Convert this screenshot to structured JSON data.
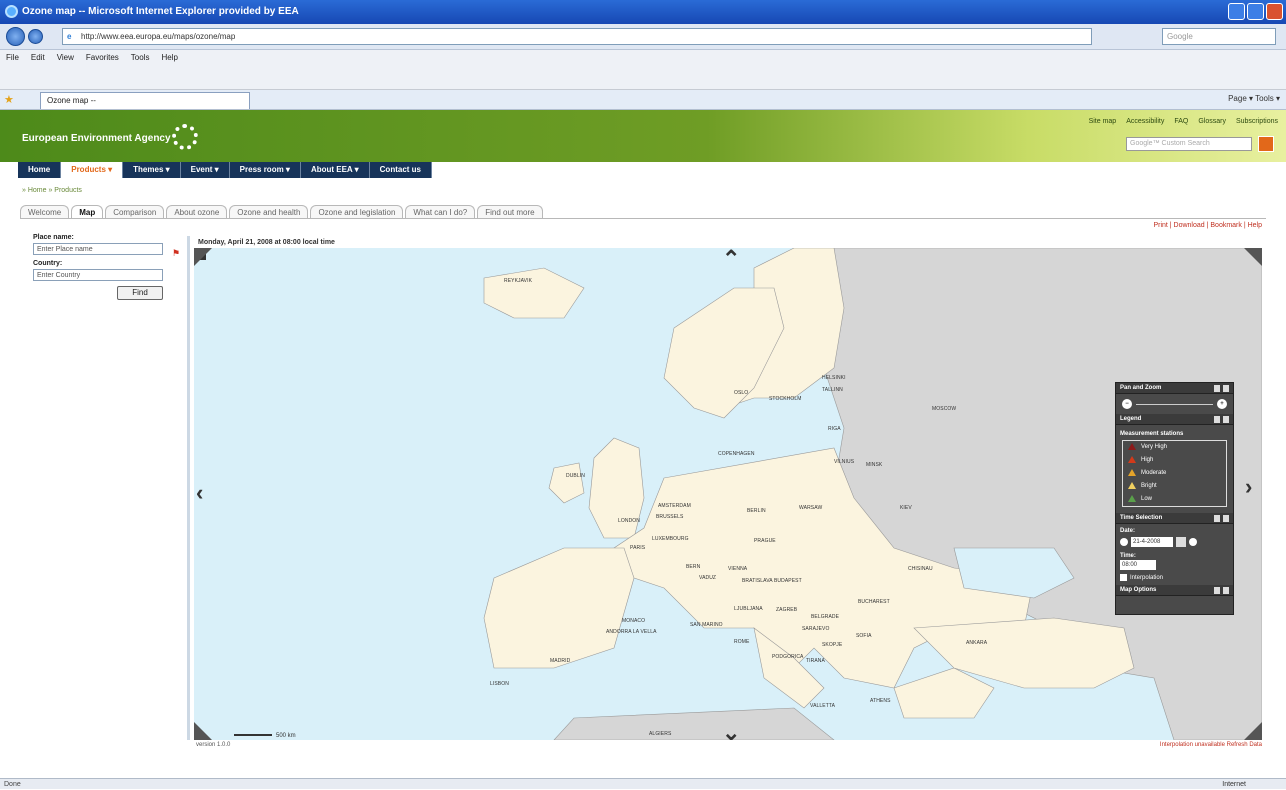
{
  "window": {
    "title": "Ozone map -- Microsoft Internet Explorer provided by EEA"
  },
  "browser": {
    "url": "http://www.eea.europa.eu/maps/ozone/map",
    "search_placeholder": "Google",
    "menus": [
      "File",
      "Edit",
      "View",
      "Favorites",
      "Tools",
      "Help"
    ],
    "tab_label": "Ozone map --",
    "tools_label": "Page ▾   Tools ▾"
  },
  "site": {
    "logo_text": "European Environment Agency",
    "top_links": [
      "Site map",
      "Accessibility",
      "FAQ",
      "Glossary",
      "Subscriptions"
    ],
    "search_placeholder": "Google™ Custom Search",
    "nav": [
      "Home",
      "Products ▾",
      "Themes ▾",
      "Event ▾",
      "Press room ▾",
      "About EEA ▾",
      "Contact us"
    ],
    "breadcrumb": "» Home » Products",
    "page_tabs": [
      "Welcome",
      "Map",
      "Comparison",
      "About ozone",
      "Ozone and health",
      "Ozone and legislation",
      "What can I do?",
      "Find out more"
    ],
    "print_links": "Print | Download | Bookmark | Help"
  },
  "left_panel": {
    "place_label": "Place name:",
    "place_placeholder": "Enter Place name",
    "country_label": "Country:",
    "country_placeholder": "Enter Country",
    "find_button": "Find"
  },
  "map": {
    "title": "Monday, April 21, 2008 at 08:00 local time",
    "scale_label": "500 km",
    "cities": [
      {
        "name": "REYKJAVIK"
      },
      {
        "name": "OSLO"
      },
      {
        "name": "STOCKHOLM"
      },
      {
        "name": "HELSINKI"
      },
      {
        "name": "TALLINN"
      },
      {
        "name": "MOSCOW"
      },
      {
        "name": "RIGA"
      },
      {
        "name": "VILNIUS"
      },
      {
        "name": "MINSK"
      },
      {
        "name": "COPENHAGEN"
      },
      {
        "name": "DUBLIN"
      },
      {
        "name": "LONDON"
      },
      {
        "name": "AMSTERDAM"
      },
      {
        "name": "BRUSSELS"
      },
      {
        "name": "LUXEMBOURG"
      },
      {
        "name": "PARIS"
      },
      {
        "name": "BERLIN"
      },
      {
        "name": "WARSAW"
      },
      {
        "name": "PRAGUE"
      },
      {
        "name": "KIEV"
      },
      {
        "name": "VIENNA"
      },
      {
        "name": "BRATISLAVA"
      },
      {
        "name": "BUDAPEST"
      },
      {
        "name": "BERN"
      },
      {
        "name": "VADUZ"
      },
      {
        "name": "LJUBLJANA"
      },
      {
        "name": "ZAGREB"
      },
      {
        "name": "BELGRADE"
      },
      {
        "name": "BUCHAREST"
      },
      {
        "name": "CHISINAU"
      },
      {
        "name": "SARAJEVO"
      },
      {
        "name": "MONACO"
      },
      {
        "name": "SAN MARINO"
      },
      {
        "name": "ANDORRA LA VELLA"
      },
      {
        "name": "MADRID"
      },
      {
        "name": "LISBON"
      },
      {
        "name": "ROME"
      },
      {
        "name": "PODGORICA"
      },
      {
        "name": "SOFIA"
      },
      {
        "name": "SKOPJE"
      },
      {
        "name": "TIRANA"
      },
      {
        "name": "ATHENS"
      },
      {
        "name": "ANKARA"
      },
      {
        "name": "VALLETTA"
      },
      {
        "name": "ALGIERS"
      }
    ]
  },
  "controls": {
    "pan_zoom": "Pan and Zoom",
    "legend": "Legend",
    "measurement": "Measurement stations",
    "levels": [
      {
        "label": "Very High",
        "color": "#8b1a1a"
      },
      {
        "label": "High",
        "color": "#d33a1a"
      },
      {
        "label": "Moderate",
        "color": "#e5a42a"
      },
      {
        "label": "Bright",
        "color": "#f0d060"
      },
      {
        "label": "Low",
        "color": "#5aa04a"
      }
    ],
    "time_selection": "Time Selection",
    "date_label": "Date:",
    "date_value": "21-4-2008",
    "time_label": "Time:",
    "time_value": "08:00",
    "interpolation": "Interpolation",
    "map_options": "Map Options"
  },
  "footer": {
    "version": "version 1.0.0",
    "links": "Interpolation unavailable   Refresh Data"
  },
  "status": {
    "left": "Done",
    "zone": "Internet"
  }
}
